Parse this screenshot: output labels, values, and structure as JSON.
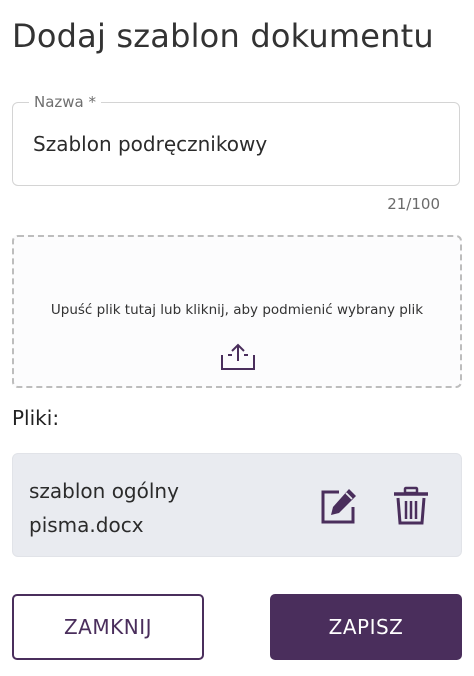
{
  "dialog": {
    "title": "Dodaj szablon dokumentu"
  },
  "name_field": {
    "label": "Nazwa *",
    "value": "Szablon podręcznikowy",
    "counter": "21/100"
  },
  "dropzone": {
    "text": "Upuść plik tutaj lub kliknij, aby podmienić wybrany plik",
    "icon": "upload-icon"
  },
  "files": {
    "label": "Pliki:",
    "items": [
      {
        "name": "szablon ogólny pisma.docx",
        "edit_icon": "edit-icon",
        "delete_icon": "trash-icon"
      }
    ]
  },
  "actions": {
    "close_label": "ZAMKNIJ",
    "save_label": "ZAPISZ"
  },
  "colors": {
    "primary": "#4a2e5c",
    "card_bg": "#e9ebf0",
    "border": "#d4d4d4"
  }
}
